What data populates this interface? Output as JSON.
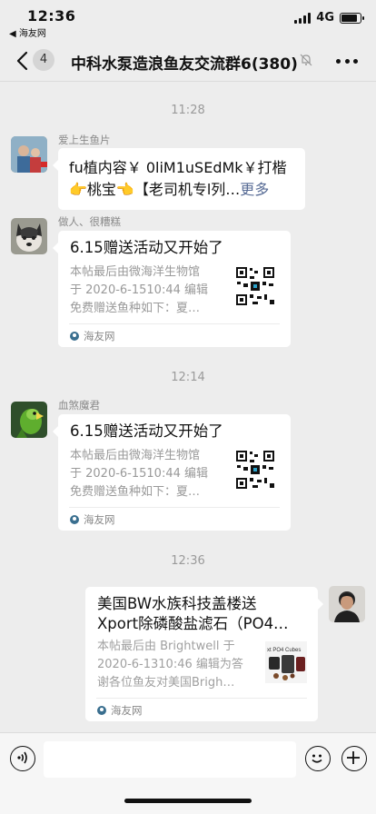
{
  "status_bar": {
    "time": "12:36",
    "back_app": "◀ 海友网",
    "network": "4G"
  },
  "nav": {
    "unread_count": "4",
    "title": "中科水泵造浪鱼友交流群6(380)"
  },
  "timestamps": [
    "11:28",
    "12:14",
    "12:36"
  ],
  "messages": [
    {
      "type": "text",
      "sender": "爱上生鱼片",
      "lines": [
        "fu植内容￥ 0liM1uSEdMk￥打楷",
        "👉桃宝👈【老司机专l列…"
      ],
      "more_label": "更多"
    },
    {
      "type": "link_card",
      "sender": "做人、很糟糕",
      "title": "6.15赠送活动又开始了",
      "desc": [
        "本帖最后由微海洋生物馆",
        "于 2020-6-1510:44 编辑",
        "免费赠送鱼种如下：夏…"
      ],
      "source": "海友网"
    },
    {
      "type": "link_card",
      "sender": "血煞魔君",
      "title": "6.15赠送活动又开始了",
      "desc": [
        "本帖最后由微海洋生物馆",
        "于 2020-6-1510:44 编辑",
        "免费赠送鱼种如下：夏…"
      ],
      "source": "海友网"
    },
    {
      "type": "link_card",
      "sender": "",
      "title_lines": [
        "美国BW水族科技盖楼送",
        "Xport除磷酸盐滤石（PO4…"
      ],
      "desc": [
        "本帖最后由 Brightwell 于",
        "2020-6-1310:46 编辑为答",
        "谢各位鱼友对美国Brigh…"
      ],
      "thumb_text": "xt PO4 Cubes",
      "source": "海友网"
    }
  ],
  "icons": [
    "back-chevron-icon",
    "mute-icon",
    "more-icon",
    "voice-icon",
    "emoji-icon",
    "plus-icon"
  ]
}
